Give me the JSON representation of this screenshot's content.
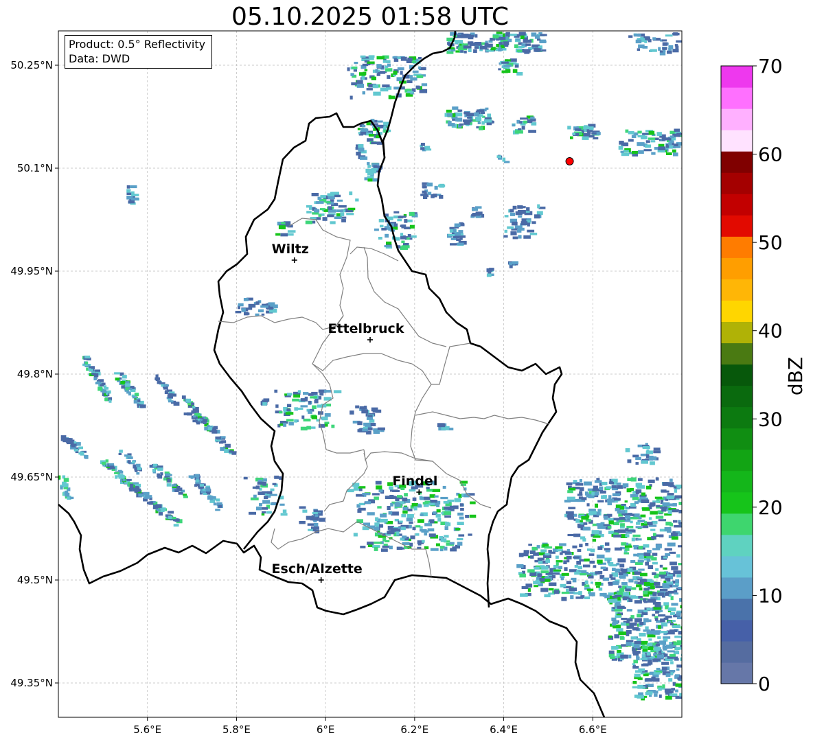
{
  "title": "05.10.2025 01:58 UTC",
  "info_box": {
    "line1": "Product: 0.5° Reflectivity",
    "line2": "Data: DWD"
  },
  "map": {
    "lon_range": [
      5.4,
      6.8
    ],
    "lat_range": [
      49.3,
      50.3
    ],
    "x_ticks": [
      {
        "value": 5.6,
        "label": "5.6°E"
      },
      {
        "value": 5.8,
        "label": "5.8°E"
      },
      {
        "value": 6.0,
        "label": "6°E"
      },
      {
        "value": 6.2,
        "label": "6.2°E"
      },
      {
        "value": 6.4,
        "label": "6.4°E"
      },
      {
        "value": 6.6,
        "label": "6.6°E"
      }
    ],
    "y_ticks": [
      {
        "value": 50.25,
        "label": "50.25°N"
      },
      {
        "value": 50.1,
        "label": "50.1°N"
      },
      {
        "value": 49.95,
        "label": "49.95°N"
      },
      {
        "value": 49.8,
        "label": "49.8°N"
      },
      {
        "value": 49.65,
        "label": "49.65°N"
      },
      {
        "value": 49.5,
        "label": "49.5°N"
      },
      {
        "value": 49.35,
        "label": "49.35°N"
      }
    ],
    "gridlines": true,
    "cities": [
      {
        "name": "Wiltz",
        "lon": 5.93,
        "lat": 49.966
      },
      {
        "name": "Ettelbruck",
        "lon": 6.1,
        "lat": 49.85
      },
      {
        "name": "Findel",
        "lon": 6.21,
        "lat": 49.628
      },
      {
        "name": "Esch/Alzette",
        "lon": 5.99,
        "lat": 49.5
      }
    ],
    "radar_marker": {
      "lon": 6.548,
      "lat": 50.11,
      "color": "#ff0000"
    },
    "echo_colors": {
      "weak": "#4a6aa6",
      "light": "#5aa0c8",
      "mid": "#62c8d0",
      "strong": "#3ed67a",
      "peak": "#16c41a"
    }
  },
  "colorbar": {
    "label": "dBZ",
    "min": 0,
    "max": 70,
    "ticks": [
      "0",
      "10",
      "20",
      "30",
      "40",
      "50",
      "60",
      "70"
    ],
    "colors": [
      "#6677a8",
      "#556ca0",
      "#4660a8",
      "#4a72aa",
      "#5b9ec8",
      "#67c2d8",
      "#5fd2c0",
      "#3ed66e",
      "#16c41a",
      "#14b61a",
      "#12a414",
      "#108e12",
      "#0c7a10",
      "#0a6a0e",
      "#07580b",
      "#4a7a12",
      "#b0b206",
      "#ffd600",
      "#ffb606",
      "#ff9e00",
      "#ff7c00",
      "#e20a00",
      "#c20000",
      "#a40000",
      "#800000",
      "#ffe2ff",
      "#ffb0ff",
      "#ff70ff",
      "#ee38ee"
    ]
  }
}
